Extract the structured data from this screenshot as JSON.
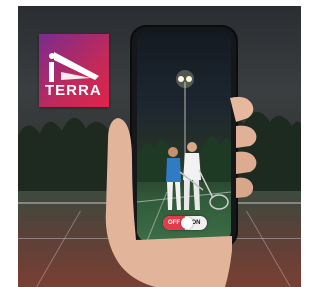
{
  "logo": {
    "text": "TERRA",
    "colors": {
      "from": "#7a2b8f",
      "to": "#e0234a"
    }
  },
  "phone_toggle": {
    "off_label": "OFF",
    "on_label": "ON",
    "state": "on"
  },
  "icons": [
    "terra-logo-icon",
    "phone-icon",
    "hand-icon",
    "stadium-light-icon"
  ]
}
